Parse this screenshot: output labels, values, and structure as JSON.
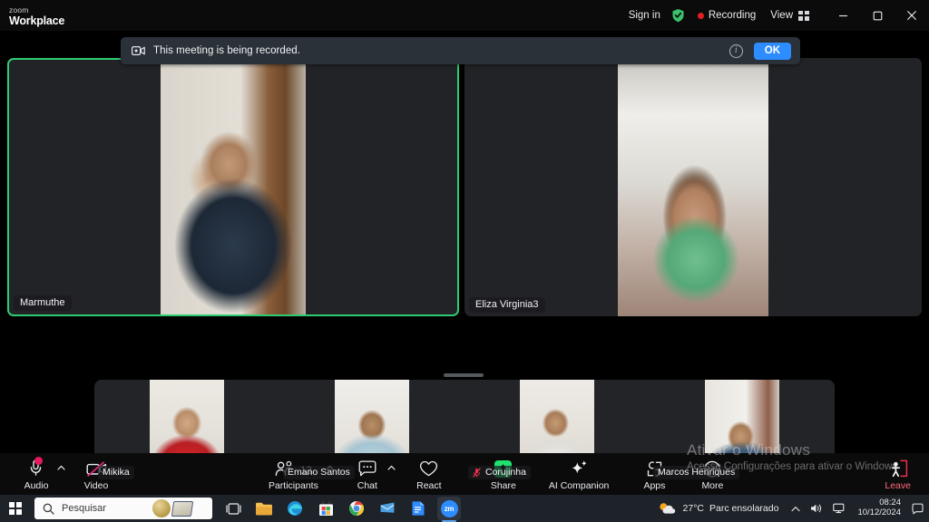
{
  "titlebar": {
    "brand_small": "zoom",
    "brand_large": "Workplace",
    "sign_in": "Sign in",
    "shield_icon": "shield-check-icon",
    "recording_label": "Recording",
    "view_label": "View",
    "view_icon": "grid-view-icon",
    "minimize_icon": "minimize-icon",
    "maximize_icon": "maximize-icon",
    "close_icon": "close-icon"
  },
  "recording_banner": {
    "icon": "video-record-icon",
    "message": "This meeting is being recorded.",
    "info_icon": "info-icon",
    "info_glyph": "i",
    "ok_label": "OK"
  },
  "stage": {
    "active_speaker_color": "#2ecc71",
    "tiles": [
      {
        "name": "Marmuthe",
        "muted": false,
        "active_speaker": true
      },
      {
        "name": "Eliza Virginia3",
        "muted": false,
        "active_speaker": false
      }
    ]
  },
  "filmstrip": {
    "handle_icon": "drag-handle",
    "tiles": [
      {
        "name": "Mikika",
        "muted": false
      },
      {
        "name": "Emano Santos",
        "muted": false
      },
      {
        "name": "Corujinha",
        "muted": true
      },
      {
        "name": "Marcos Henriques",
        "muted": false
      }
    ]
  },
  "watermark": {
    "title": "Ativar o Windows",
    "subtitle": "Acesse Configurações para ativar o Windows"
  },
  "toolbar": {
    "left": [
      {
        "label": "Audio",
        "icon": "microphone-icon",
        "has_caret": true,
        "badge": true
      },
      {
        "label": "Video",
        "icon": "camera-off-icon",
        "has_caret": false
      }
    ],
    "center": [
      {
        "label": "Participants",
        "icon": "participants-icon",
        "count": "13",
        "has_caret": true
      },
      {
        "label": "Chat",
        "icon": "chat-icon",
        "has_caret": true
      },
      {
        "label": "React",
        "icon": "heart-icon",
        "has_caret": false
      },
      {
        "label": "Share",
        "icon": "share-screen-icon",
        "has_caret": false
      },
      {
        "label": "AI Companion",
        "icon": "sparkle-icon",
        "has_caret": false
      },
      {
        "label": "Apps",
        "icon": "apps-icon",
        "has_caret": false
      },
      {
        "label": "More",
        "icon": "more-dots-icon",
        "has_caret": false
      }
    ],
    "right": [
      {
        "label": "Leave",
        "icon": "leave-door-icon",
        "color": "#ff6b7a"
      }
    ]
  },
  "taskbar": {
    "start_icon": "windows-start-icon",
    "search_placeholder": "Pesquisar",
    "search_icon": "search-icon",
    "apps": [
      {
        "icon": "task-view-icon",
        "name": "task-view"
      },
      {
        "icon": "file-explorer-icon",
        "name": "file-explorer"
      },
      {
        "icon": "edge-icon",
        "name": "microsoft-edge"
      },
      {
        "icon": "store-icon",
        "name": "microsoft-store"
      },
      {
        "icon": "chrome-icon",
        "name": "google-chrome"
      },
      {
        "icon": "mail-icon",
        "name": "mail"
      },
      {
        "icon": "word-icon",
        "name": "office-document"
      },
      {
        "icon": "zoom-icon",
        "name": "zoom"
      }
    ],
    "tray": {
      "weather_temp": "27°C",
      "weather_desc": "Parc ensolarado",
      "weather_icon": "sun-cloud-icon",
      "chevron_icon": "chevron-up-icon",
      "volume_icon": "speaker-icon",
      "network_icon": "network-icon",
      "time": "08:24",
      "date": "10/12/2024",
      "notification_icon": "notification-bell-icon"
    }
  }
}
